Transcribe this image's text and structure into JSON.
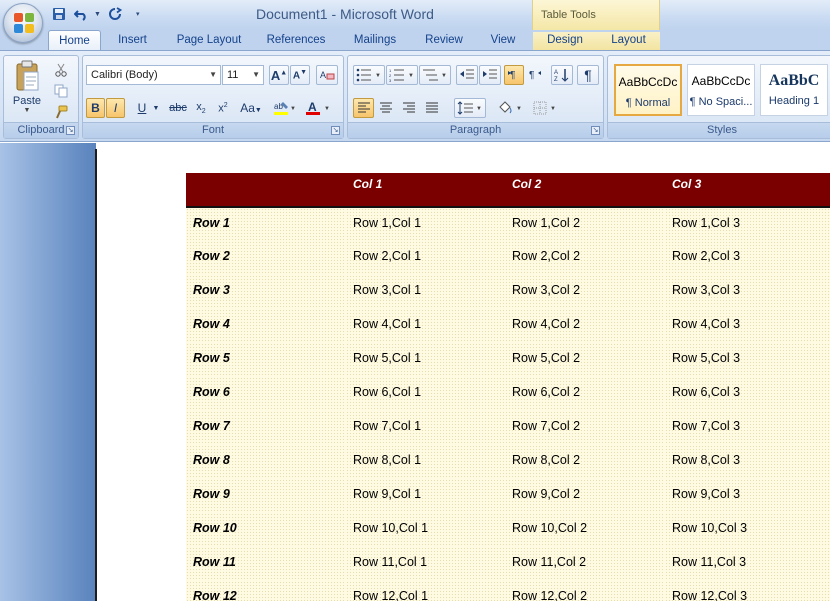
{
  "window": {
    "title": "Document1 - Microsoft Word",
    "contextual_tab_group": "Table Tools"
  },
  "quick_access": {
    "items": [
      "save-icon",
      "undo-icon",
      "redo-icon",
      "customize-icon"
    ]
  },
  "tabs": [
    "Home",
    "Insert",
    "Page Layout",
    "References",
    "Mailings",
    "Review",
    "View",
    "Design",
    "Layout"
  ],
  "active_tab": "Home",
  "ribbon": {
    "clipboard": {
      "label": "Clipboard",
      "paste_label": "Paste"
    },
    "font": {
      "label": "Font",
      "font_name": "Calibri (Body)",
      "font_size": "11"
    },
    "paragraph": {
      "label": "Paragraph"
    },
    "styles": {
      "label": "Styles",
      "tiles": [
        {
          "sample": "AaBbCcDc",
          "name": "¶ Normal"
        },
        {
          "sample": "AaBbCcDc",
          "name": "¶ No Spaci..."
        },
        {
          "sample": "AaBbC",
          "name": "Heading 1"
        }
      ]
    }
  },
  "accent_colors": {
    "table_header_bg": "#7a0000",
    "table_body_bg": "#fffbe3",
    "ribbon_bg": "#d4e2f4",
    "selected_style_border": "#e6a841"
  },
  "table": {
    "headers": [
      "",
      "Col 1",
      "Col 2",
      "Col 3"
    ],
    "rows": [
      [
        "Row 1",
        "Row 1,Col 1",
        "Row 1,Col 2",
        "Row 1,Col 3"
      ],
      [
        "Row 2",
        "Row 2,Col 1",
        "Row 2,Col 2",
        "Row 2,Col 3"
      ],
      [
        "Row 3",
        "Row 3,Col 1",
        "Row 3,Col 2",
        "Row 3,Col 3"
      ],
      [
        "Row 4",
        "Row 4,Col 1",
        "Row 4,Col 2",
        "Row 4,Col 3"
      ],
      [
        "Row 5",
        "Row 5,Col 1",
        "Row 5,Col 2",
        "Row 5,Col 3"
      ],
      [
        "Row 6",
        "Row 6,Col 1",
        "Row 6,Col 2",
        "Row 6,Col 3"
      ],
      [
        "Row 7",
        "Row 7,Col 1",
        "Row 7,Col 2",
        "Row 7,Col 3"
      ],
      [
        "Row 8",
        "Row 8,Col 1",
        "Row 8,Col 2",
        "Row 8,Col 3"
      ],
      [
        "Row 9",
        "Row 9,Col 1",
        "Row 9,Col 2",
        "Row 9,Col 3"
      ],
      [
        "Row 10",
        "Row 10,Col 1",
        "Row 10,Col 2",
        "Row 10,Col 3"
      ],
      [
        "Row 11",
        "Row 11,Col 1",
        "Row 11,Col 2",
        "Row 11,Col 3"
      ],
      [
        "Row 12",
        "Row 12,Col 1",
        "Row 12,Col 2",
        "Row 12,Col 3"
      ]
    ]
  }
}
